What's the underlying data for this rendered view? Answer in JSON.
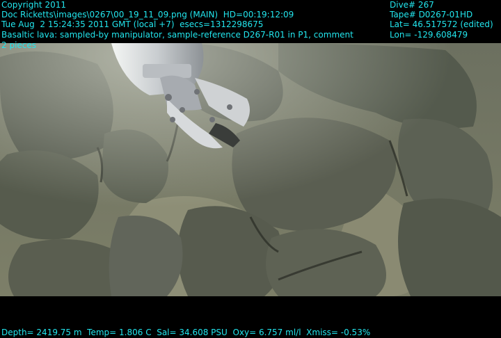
{
  "overlay": {
    "copyright": "Copyright 2011",
    "source_line": "Doc Ricketts\\images\\0267\\00_19_11_09.png (MAIN)  HD=00:19:12:09",
    "time_line": "Tue Aug  2 15:24:35 2011 GMT (local +7)  esecs=1312298675",
    "comment_line": "Basaltic lava: sampled-by manipulator, sample-reference D267-R01 in P1, comment",
    "comment_cont": "2 pieces",
    "dive": "Dive# 267",
    "tape": "Tape# D0267-01HD",
    "lat": "Lat= 46.517572 (edited)",
    "lon": "Lon= -129.608479",
    "sensors": "Depth= 2419.75 m  Temp= 1.806 C  Sal= 34.608 PSU  Oxy= 6.757 ml/l  Xmiss= -0.53%"
  },
  "colors": {
    "overlay_text": "#22e6ee",
    "band": "#000000",
    "seafloor": "#8a8c74",
    "rock": "#5f6456"
  }
}
